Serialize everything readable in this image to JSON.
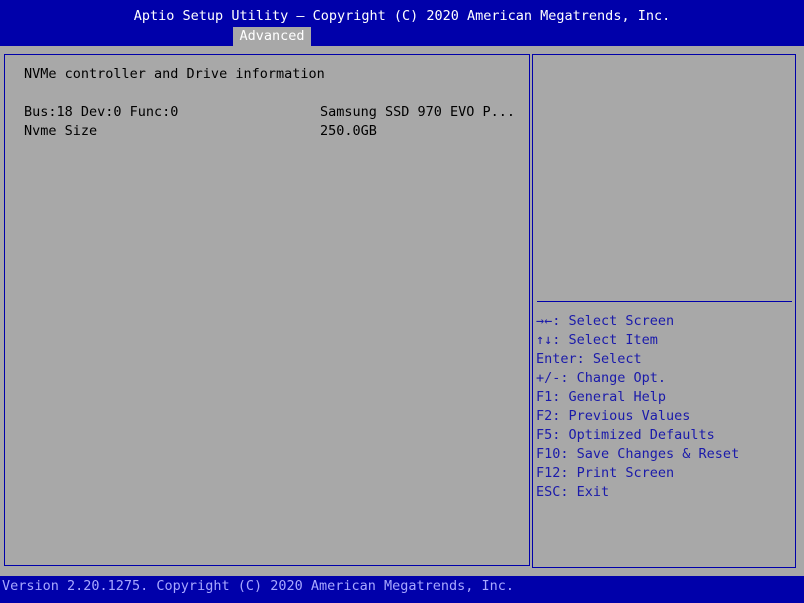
{
  "header": {
    "title": "Aptio Setup Utility – Copyright (C) 2020 American Megatrends, Inc.",
    "tab": "Advanced"
  },
  "main": {
    "section_title": "NVMe controller and Drive information",
    "rows": [
      {
        "label": "Bus:18 Dev:0 Func:0",
        "value": "Samsung SSD 970 EVO P..."
      },
      {
        "label": "Nvme Size",
        "value": "250.0GB"
      }
    ]
  },
  "help": {
    "items": [
      "→←: Select Screen",
      "↑↓: Select Item",
      "Enter: Select",
      "+/-: Change Opt.",
      "F1: General Help",
      "F2: Previous Values",
      "F5: Optimized Defaults",
      "F10: Save Changes & Reset",
      "F12: Print Screen",
      "ESC: Exit"
    ]
  },
  "footer": {
    "text": "Version 2.20.1275. Copyright (C) 2020 American Megatrends, Inc."
  },
  "colors": {
    "background": "#a8a8a8",
    "bar": "#0000aa",
    "help_text": "#1a1aaa"
  }
}
